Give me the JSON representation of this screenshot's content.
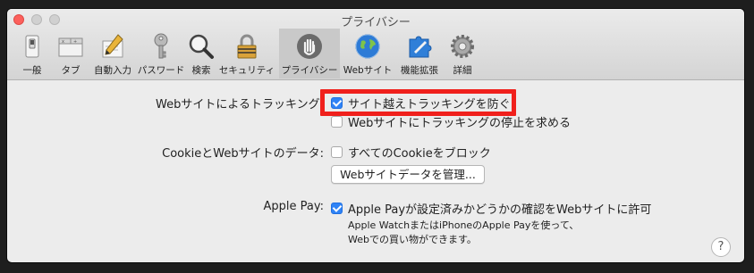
{
  "window": {
    "title": "プライバシー"
  },
  "toolbar": {
    "items": [
      {
        "label": "一般",
        "icon": "general-switch-icon"
      },
      {
        "label": "タブ",
        "icon": "tabs-window-icon"
      },
      {
        "label": "自動入力",
        "icon": "pencil-icon"
      },
      {
        "label": "パスワード",
        "icon": "key-icon"
      },
      {
        "label": "検索",
        "icon": "magnifier-icon"
      },
      {
        "label": "セキュリティ",
        "icon": "lock-icon"
      },
      {
        "label": "プライバシー",
        "icon": "hand-icon"
      },
      {
        "label": "Webサイト",
        "icon": "globe-icon"
      },
      {
        "label": "機能拡張",
        "icon": "puzzle-icon"
      },
      {
        "label": "詳細",
        "icon": "gear-icon"
      }
    ],
    "active_index": 6
  },
  "tracking": {
    "label": "Webサイトによるトラッキング:",
    "prevent_cross_site": {
      "label": "サイト越えトラッキングを防ぐ",
      "checked": true
    },
    "ask_not_track": {
      "label": "Webサイトにトラッキングの停止を求める",
      "checked": false
    }
  },
  "cookies": {
    "label": "CookieとWebサイトのデータ:",
    "block_all": {
      "label": "すべてのCookieをブロック",
      "checked": false
    },
    "manage_button": "Webサイトデータを管理..."
  },
  "apple_pay": {
    "label": "Apple Pay:",
    "allow_check": {
      "label": "Apple Payが設定済みかどうかの確認をWebサイトに許可",
      "checked": true
    },
    "note_line1": "Apple WatchまたはiPhoneのApple Payを使って、",
    "note_line2": "Webでの買い物ができます。"
  },
  "help_button": "?",
  "colors": {
    "accent": "#2f83f6",
    "highlight_box": "#f0201c",
    "window_bg": "#ececec"
  }
}
